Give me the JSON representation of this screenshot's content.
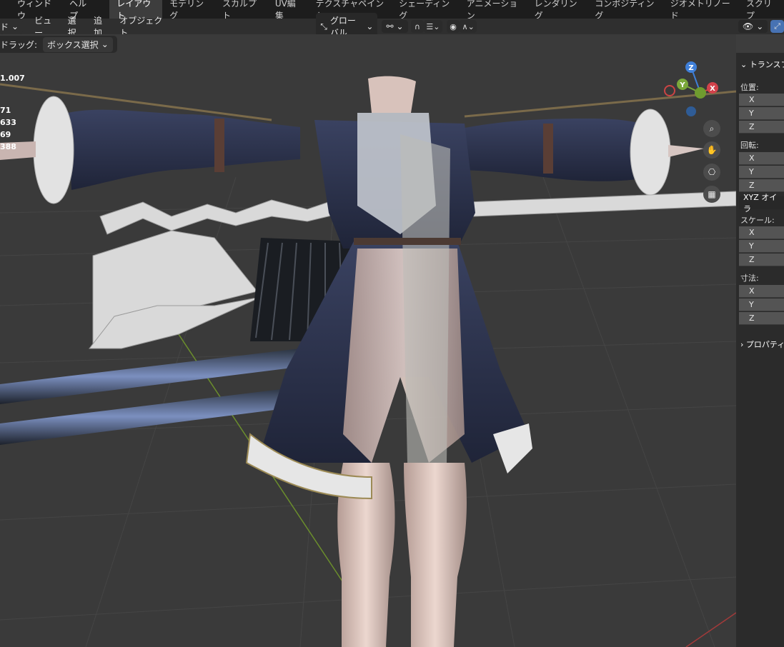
{
  "menubar": {
    "window": "ウィンドウ",
    "help": "ヘルプ"
  },
  "workspaces": [
    "レイアウト",
    "モデリング",
    "スカルプト",
    "UV編集",
    "テクスチャペイント",
    "シェーディング",
    "アニメーション",
    "レンダリング",
    "コンポジティング",
    "ジオメトリノード",
    "スクリプ"
  ],
  "header": {
    "mode_label": "ド",
    "view": "ビュー",
    "select": "選択",
    "add": "追加",
    "object": "オブジェクト",
    "transform_orientation": "グローバル"
  },
  "toolbar": {
    "drag_label": "ドラッグ:",
    "drag_value": "ボックス選択"
  },
  "stats": [
    "1.007",
    "71",
    "633",
    "69",
    "388"
  ],
  "gizmo": {
    "z": "Z",
    "y": "Y",
    "x": "X"
  },
  "npanel": {
    "transform_title": "トランスフ",
    "location": "位置:",
    "rotation": "回転:",
    "rotation_mode": "XYZ オイラ",
    "scale": "スケール:",
    "dimensions": "寸法:",
    "properties_title": "プロパティ",
    "axes": [
      "X",
      "Y",
      "Z"
    ]
  },
  "colors": {
    "accent_tab": "#3d3d3d",
    "x_axis": "#d2424b",
    "y_axis": "#7ba83b",
    "z_axis": "#3f7fd8"
  }
}
